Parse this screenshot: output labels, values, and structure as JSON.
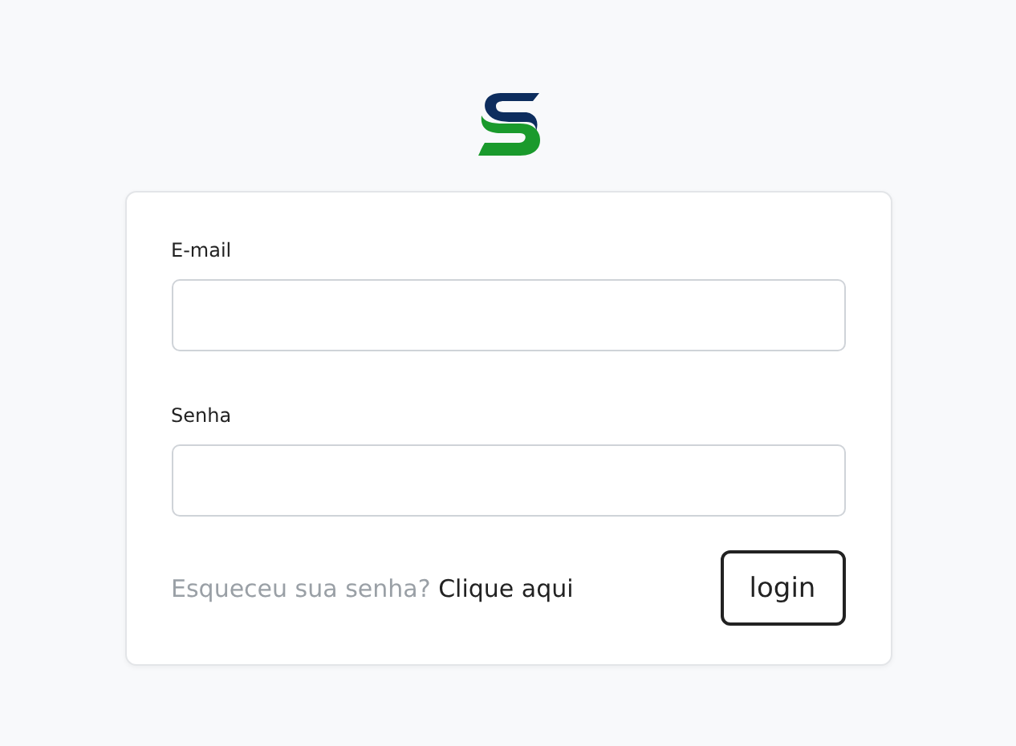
{
  "fields": [
    {
      "label": "E-mail"
    },
    {
      "label": "Senha"
    }
  ],
  "forgot": {
    "text": "Esqueceu sua senha?",
    "link": "Clique aqui"
  },
  "login_button": "login"
}
